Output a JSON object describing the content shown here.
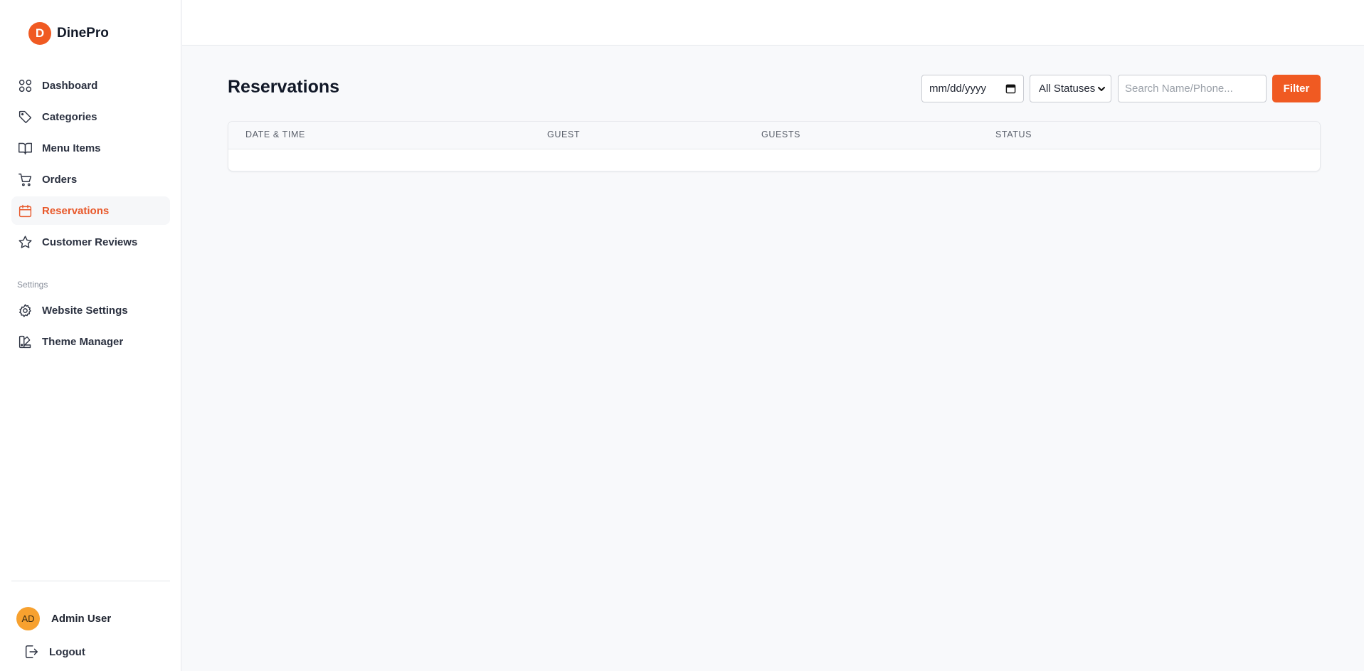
{
  "brand": {
    "logo_letter": "D",
    "name": "DinePro",
    "accent": "#f05a22"
  },
  "sidebar": {
    "items": [
      {
        "label": "Dashboard",
        "icon": "grid-icon"
      },
      {
        "label": "Categories",
        "icon": "tag-icon"
      },
      {
        "label": "Menu Items",
        "icon": "book-icon"
      },
      {
        "label": "Orders",
        "icon": "cart-icon"
      },
      {
        "label": "Reservations",
        "icon": "calendar-icon",
        "active": true
      },
      {
        "label": "Customer Reviews",
        "icon": "star-icon"
      }
    ],
    "settings_label": "Settings",
    "settings_items": [
      {
        "label": "Website Settings",
        "icon": "gear-icon"
      },
      {
        "label": "Theme Manager",
        "icon": "palette-icon"
      }
    ],
    "user": {
      "initials": "AD",
      "name": "Admin User"
    },
    "logout_label": "Logout"
  },
  "main": {
    "title": "Reservations",
    "filters": {
      "date_placeholder": "mm/dd/yyyy",
      "status_selected": "All Statuses",
      "search_placeholder": "Search Name/Phone...",
      "filter_label": "Filter"
    },
    "table": {
      "columns": [
        "Date & Time",
        "Guest",
        "Guests",
        "Status"
      ],
      "rows": []
    }
  }
}
